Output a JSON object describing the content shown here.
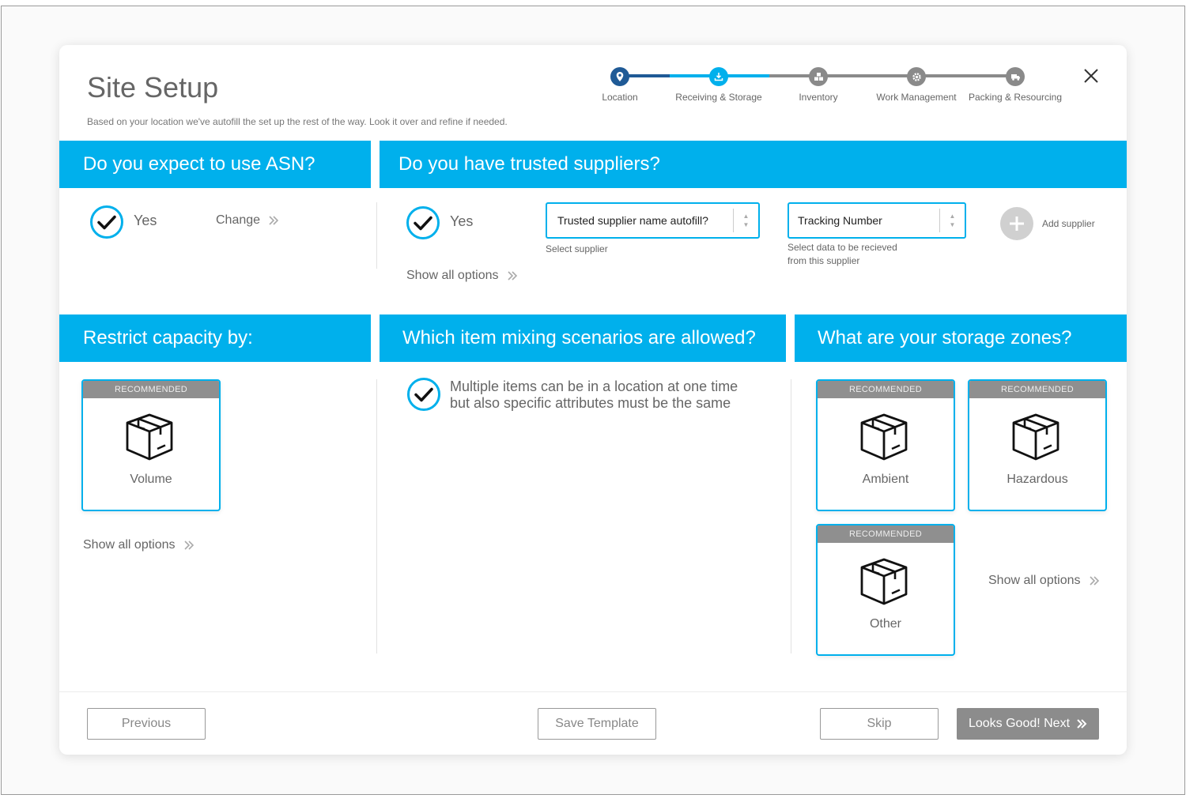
{
  "header": {
    "title": "Site Setup",
    "subtitle": "Based on your location we've autofill the set up the rest of the way. Look it over and refine if needed."
  },
  "stepper": {
    "steps": [
      {
        "label": "Location",
        "icon": "location-pin-icon",
        "color": "#1f5a96"
      },
      {
        "label": "Receiving & Storage",
        "icon": "download-tray-icon",
        "color": "#00b0ec"
      },
      {
        "label": "Inventory",
        "icon": "boxes-icon",
        "color": "#8a8a8a"
      },
      {
        "label": "Work Management",
        "icon": "gear-icon",
        "color": "#8a8a8a"
      },
      {
        "label": "Packing & Resourcing",
        "icon": "truck-icon",
        "color": "#8a8a8a"
      }
    ]
  },
  "asn": {
    "heading": "Do you expect to use ASN?",
    "answer": "Yes",
    "change_label": "Change"
  },
  "suppliers": {
    "heading": "Do you have trusted suppliers?",
    "answer": "Yes",
    "supplier_select": {
      "value": "Trusted supplier name autofill?",
      "hint": "Select supplier"
    },
    "data_select": {
      "value": "Tracking Number",
      "hint_line1": "Select data to be recieved",
      "hint_line2": "from this supplier"
    },
    "add_label": "Add supplier",
    "show_all": "Show all options"
  },
  "capacity": {
    "heading": "Restrict capacity by:",
    "cards": [
      {
        "badge": "RECOMMENDED",
        "label": "Volume"
      }
    ],
    "show_all": "Show all options"
  },
  "mixing": {
    "heading": "Which item mixing scenarios are allowed?",
    "line1": "Multiple items can be in a location at one time",
    "line2": "but also specific attributes must be the same"
  },
  "zones": {
    "heading": "What are your storage zones?",
    "cards": [
      {
        "badge": "RECOMMENDED",
        "label": "Ambient"
      },
      {
        "badge": "RECOMMENDED",
        "label": "Hazardous"
      },
      {
        "badge": "RECOMMENDED",
        "label": "Other"
      }
    ],
    "show_all": "Show all options"
  },
  "footer": {
    "previous": "Previous",
    "save_template": "Save Template",
    "skip": "Skip",
    "next": "Looks Good! Next"
  },
  "colors": {
    "accent": "#00b0ec",
    "done": "#1f5a96",
    "inactive": "#8a8a8a"
  }
}
